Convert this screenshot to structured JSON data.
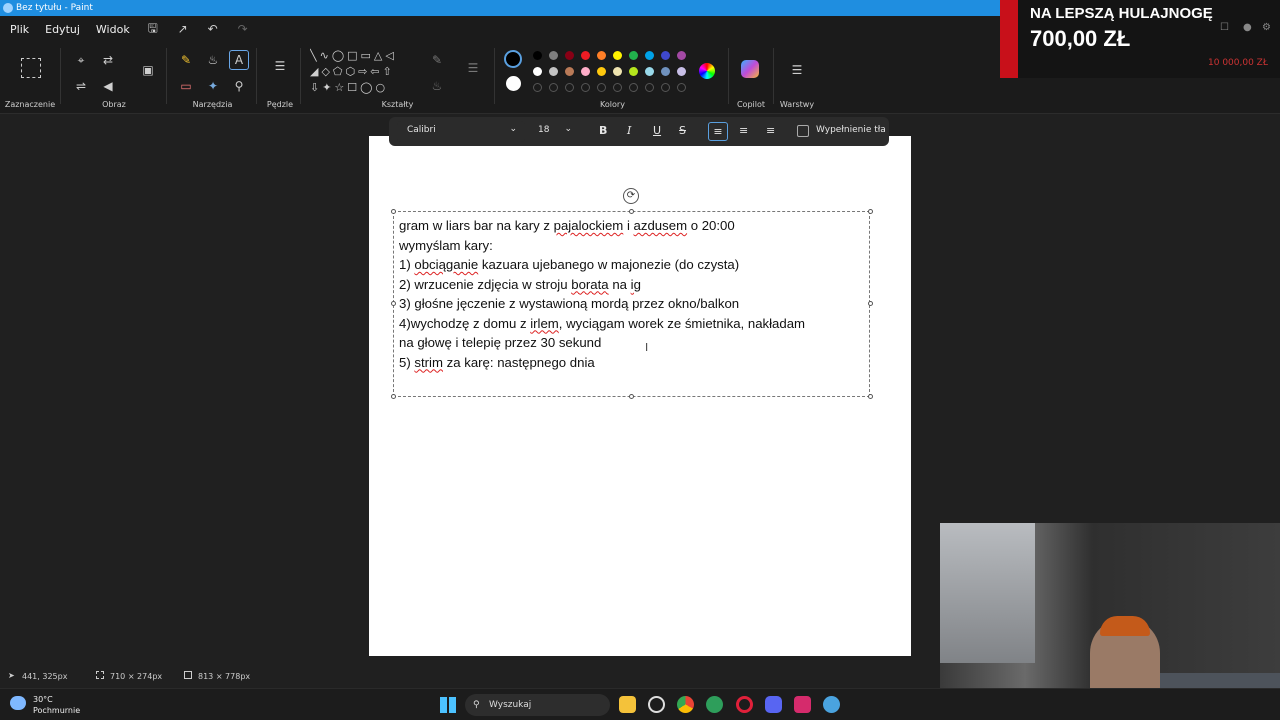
{
  "window": {
    "title": "Bez tytułu - Paint"
  },
  "menu": {
    "file": "Plik",
    "edit": "Edytuj",
    "view": "Widok"
  },
  "ribbon": {
    "groups": {
      "selection": "Zaznaczenie",
      "image": "Obraz",
      "tools": "Narzędzia",
      "brushes": "Pędzle",
      "shapes": "Kształty",
      "colors": "Kolory",
      "copilot": "Copilot",
      "layers": "Warstwy"
    },
    "palette_row1": [
      "#000000",
      "#7f7f7f",
      "#880015",
      "#ed1c24",
      "#ff7f27",
      "#fff200",
      "#22b14c",
      "#00a2e8",
      "#3f48cc",
      "#a349a4"
    ],
    "palette_row2": [
      "#ffffff",
      "#c3c3c3",
      "#b97a57",
      "#ffaec9",
      "#ffc90e",
      "#efe4b0",
      "#b5e61d",
      "#99d9ea",
      "#7092be",
      "#c8bfe7"
    ]
  },
  "textbar": {
    "font": "Calibri",
    "size": "18",
    "bold": "B",
    "italic": "I",
    "underline": "U",
    "strike": "S",
    "fill_label": "Wypełnienie tła"
  },
  "document": {
    "lines": [
      "gram w liars bar na kary z pajalockiem i azdusem o 20:00",
      "wymyślam kary:",
      "1) obciąganie kazuara ujebanego w majonezie (do czysta)",
      "2) wrzucenie zdjęcia w stroju borata na ig",
      "3) głośne jęczenie z wystawioną mordą przez okno/balkon",
      "4)wychodzę z domu z irlem, wyciągam worek ze śmietnika, nakładam",
      "na głowę i telepię przez 30 sekund",
      "5) strim za karę: następnego dnia"
    ]
  },
  "status": {
    "cursor": "441, 325px",
    "selection": "710 × 274px",
    "canvas": "813 × 778px"
  },
  "taskbar": {
    "temperature": "30°C",
    "condition": "Pochmurnie",
    "search_placeholder": "Wyszukaj"
  },
  "overlay": {
    "headline": "NA LEPSZĄ HULAJNOGĘ",
    "amount": "700,00 ZŁ",
    "goal": "10 000,00 ZŁ"
  }
}
